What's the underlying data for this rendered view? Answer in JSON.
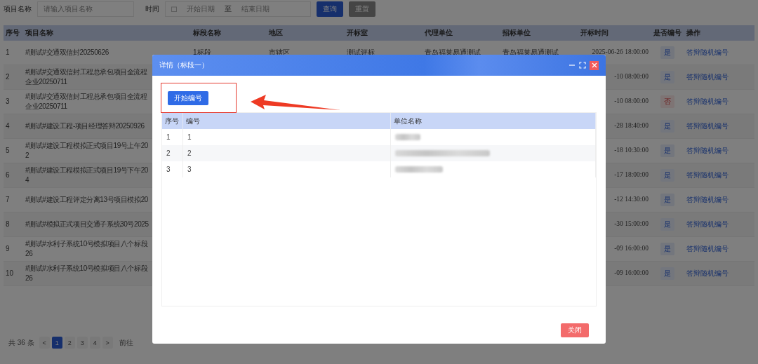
{
  "filters": {
    "name_label": "项目名称",
    "name_placeholder": "请输入项目名称",
    "time_label": "时间",
    "start_placeholder": "开始日期",
    "range_separator": "至",
    "end_placeholder": "结束日期",
    "buttons": [
      {
        "label": "查询",
        "kind": "primary"
      },
      {
        "label": "重置",
        "kind": "secondary"
      }
    ]
  },
  "table": {
    "columns": [
      "序号",
      "项目名称",
      "标段名称",
      "地区",
      "开标室",
      "代理单位",
      "招标单位",
      "开标时间",
      "是否编号",
      "操作"
    ],
    "rows": [
      {
        "index": "1",
        "name": [
          "#测试#交通双信封20250626"
        ],
        "section": "1标段",
        "region": "市辖区",
        "room": "测试评标",
        "agency": "青岛福莱易通测试",
        "tenderer": "青岛福莱易通测试",
        "time": "2025-06-26 18:00:00",
        "tag": {
          "text": "是",
          "kind": "yes"
        },
        "action": "答辩随机编号"
      },
      {
        "index": "2",
        "name": [
          "#测试#交通双信封工程总承包项目全流程",
          "企业20250711"
        ],
        "time": "-10 08:00:00",
        "tag": {
          "text": "是",
          "kind": "yes"
        },
        "action": "答辩随机编号"
      },
      {
        "index": "3",
        "name": [
          "#测试#交通双信封工程总承包项目全流程",
          "企业20250711"
        ],
        "time": "-10 08:00:00",
        "tag": {
          "text": "否",
          "kind": "no"
        },
        "action": "答辩随机编号"
      },
      {
        "index": "4",
        "name": [
          "#测试#建设工程-项目经理答辩20250926"
        ],
        "time": "-28 18:40:00",
        "tag": {
          "text": "是",
          "kind": "yes"
        },
        "action": "答辩随机编号"
      },
      {
        "index": "5",
        "name": [
          "#测试#建设工程模拟正式项目19号上午20",
          "2"
        ],
        "time": "-18 10:30:00",
        "tag": {
          "text": "是",
          "kind": "yes"
        },
        "action": "答辩随机编号"
      },
      {
        "index": "6",
        "name": [
          "#测试#建设工程模拟正式项目19号下午20",
          "4"
        ],
        "time": "-17 18:00:00",
        "tag": {
          "text": "是",
          "kind": "yes"
        },
        "action": "答辩随机编号"
      },
      {
        "index": "7",
        "name": [
          "#测试#建设工程评定分离13号项目模拟20"
        ],
        "time": "-12 14:30:00",
        "tag": {
          "text": "是",
          "kind": "yes"
        },
        "action": "答辩随机编号"
      },
      {
        "index": "8",
        "name": [
          "#测试#模拟正式项目交通子系统30号2025"
        ],
        "time": "-30 15:00:00",
        "tag": {
          "text": "是",
          "kind": "yes"
        },
        "action": "答辩随机编号"
      },
      {
        "index": "9",
        "name": [
          "#测试#水利子系统10号模拟项目八个标段",
          "26"
        ],
        "time": "-09 16:00:00",
        "tag": {
          "text": "是",
          "kind": "yes"
        },
        "action": "答辩随机编号"
      },
      {
        "index": "10",
        "name": [
          "#测试#水利子系统10号模拟项目八个标段",
          "26"
        ],
        "time": "-09 16:00:00",
        "tag": {
          "text": "是",
          "kind": "yes"
        },
        "action": "答辩随机编号"
      }
    ]
  },
  "pagination": {
    "total": "共 36 条",
    "prev": "<",
    "next": ">",
    "pages": [
      {
        "label": "1",
        "selected": true
      },
      {
        "label": "2",
        "selected": false
      },
      {
        "label": "3",
        "selected": false
      },
      {
        "label": "4",
        "selected": false
      }
    ],
    "goto_label": "前往"
  },
  "dialog": {
    "title": "详情（标段一）",
    "start_button": "开始编号",
    "columns": [
      "序号",
      "编号",
      "单位名称"
    ],
    "rows": [
      {
        "index": "1",
        "number": "1"
      },
      {
        "index": "2",
        "number": "2"
      },
      {
        "index": "3",
        "number": "3"
      }
    ],
    "close_button": "关闭"
  }
}
